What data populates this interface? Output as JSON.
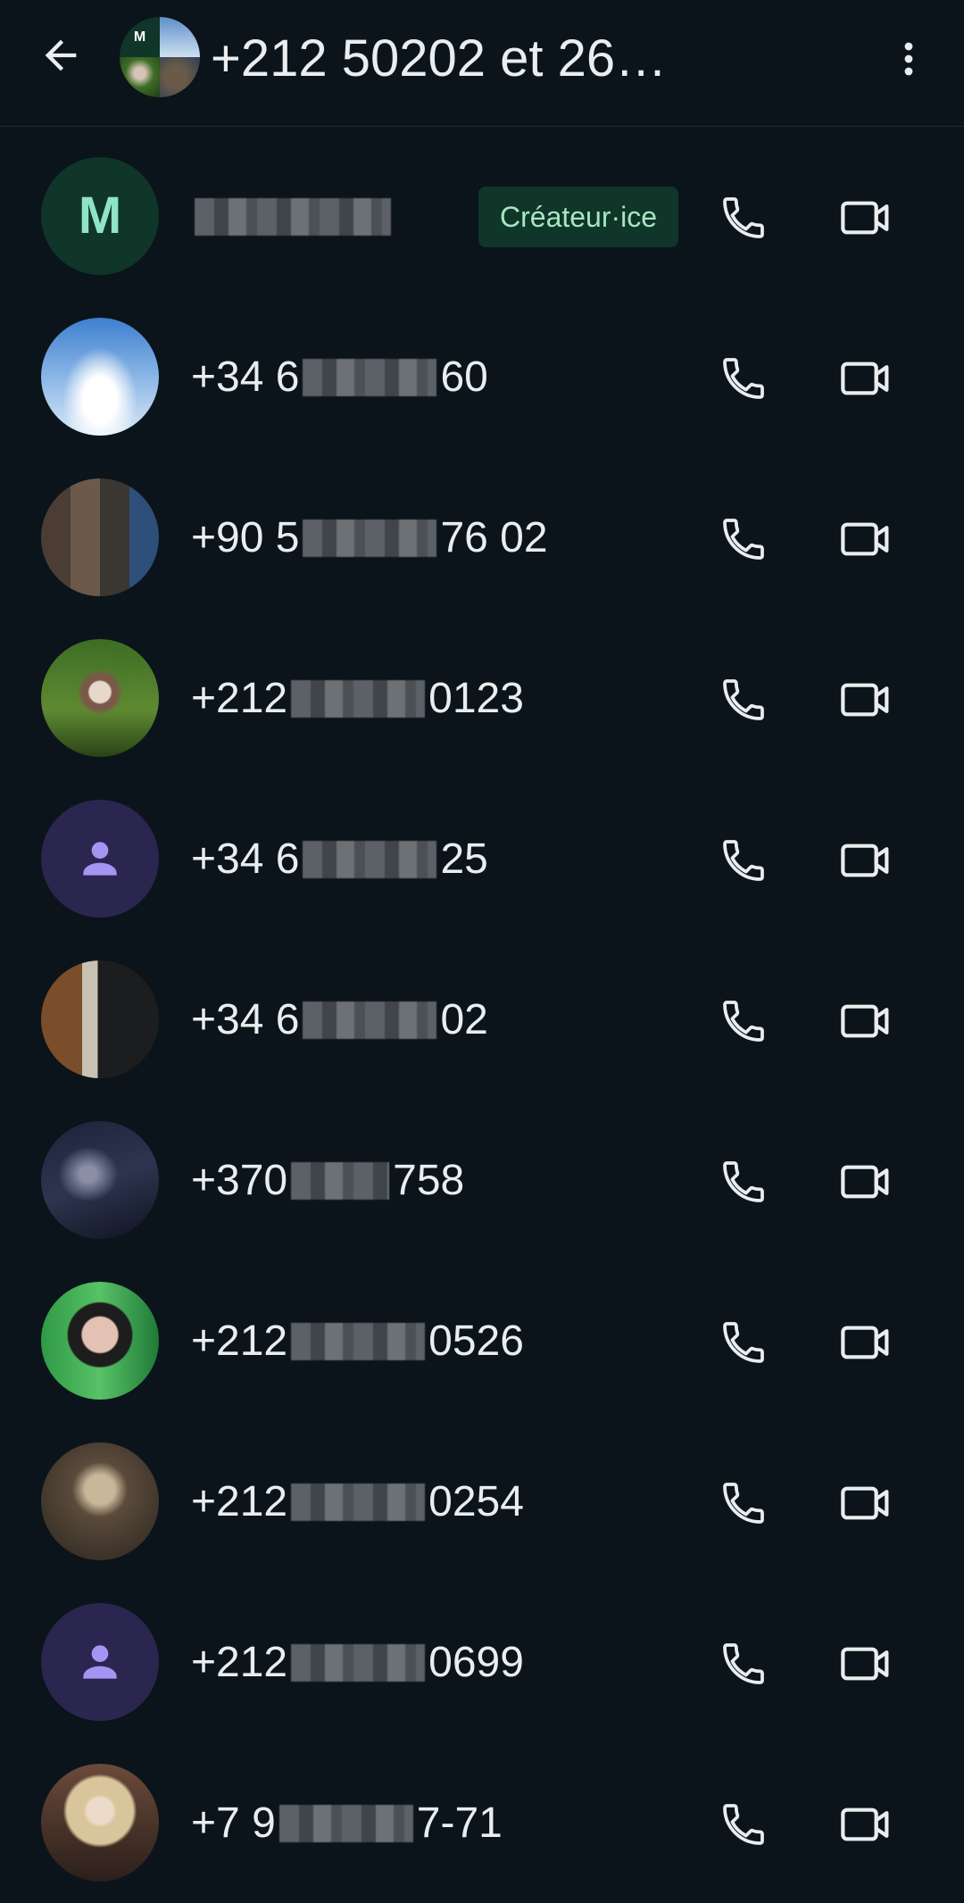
{
  "header": {
    "title": "+212 50202 et 26…",
    "back_icon": "arrow-left-icon",
    "menu_icon": "more-vertical-icon",
    "group_avatar_letter": "M"
  },
  "participants": [
    {
      "avatar_type": "initial",
      "initial": "M",
      "name_prefix": "",
      "name_suffix": "",
      "blur": "long",
      "badge": "Créateur·ice"
    },
    {
      "avatar_type": "photo",
      "photo": "sky",
      "name_prefix": "+34 6",
      "name_suffix": "60",
      "blur": "med",
      "badge": ""
    },
    {
      "avatar_type": "photo",
      "photo": "pixelated",
      "name_prefix": "+90 5",
      "name_suffix": "76 02",
      "blur": "med",
      "badge": ""
    },
    {
      "avatar_type": "photo",
      "photo": "forest",
      "name_prefix": "+212",
      "name_suffix": "0123",
      "blur": "med",
      "badge": ""
    },
    {
      "avatar_type": "default",
      "name_prefix": "+34 6",
      "name_suffix": "25",
      "blur": "med",
      "badge": ""
    },
    {
      "avatar_type": "photo",
      "photo": "stairs",
      "name_prefix": "+34 6",
      "name_suffix": "02",
      "blur": "med",
      "badge": ""
    },
    {
      "avatar_type": "photo",
      "photo": "milkyway",
      "name_prefix": "+370",
      "name_suffix": "758",
      "blur": "short",
      "badge": ""
    },
    {
      "avatar_type": "photo",
      "photo": "portrait-green",
      "name_prefix": "+212",
      "name_suffix": "0526",
      "blur": "med",
      "badge": ""
    },
    {
      "avatar_type": "photo",
      "photo": "lights",
      "name_prefix": "+212",
      "name_suffix": "0254",
      "blur": "med",
      "badge": ""
    },
    {
      "avatar_type": "default",
      "name_prefix": "+212",
      "name_suffix": "0699",
      "blur": "med",
      "badge": ""
    },
    {
      "avatar_type": "photo",
      "photo": "blonde",
      "name_prefix": "+7 9",
      "name_suffix": "7-71",
      "blur": "med",
      "badge": ""
    }
  ],
  "row_icons": {
    "voice": "phone-icon",
    "video": "video-camera-icon"
  },
  "colors": {
    "background": "#0b141a",
    "text": "#e9edef",
    "badge_bg": "#103529",
    "badge_text": "#a6e6c0",
    "default_avatar_bg": "#2b2650",
    "default_avatar_icon": "#a594f2"
  }
}
